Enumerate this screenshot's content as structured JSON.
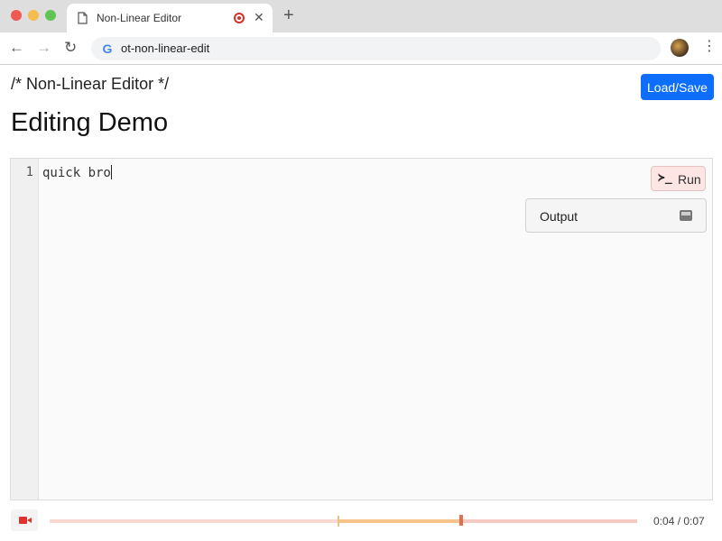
{
  "browser": {
    "tab_title": "Non-Linear Editor",
    "url": "ot-non-linear-edit",
    "new_tab": "+",
    "close": "✕"
  },
  "header": {
    "brand": "/* Non-Linear Editor */",
    "load_save_label": "Load/Save"
  },
  "main": {
    "title": "Editing Demo"
  },
  "editor": {
    "line_number": "1",
    "code": "quick bro",
    "run_label": "Run",
    "terminal_glyph": "≻_",
    "output_label": "Output"
  },
  "playback": {
    "time": "0:04 / 0:07",
    "progress_fraction": 0.7,
    "selection_start_fraction": 0.49,
    "selection_end_fraction": 0.7
  },
  "colors": {
    "accent": "#0d6efd",
    "record": "#e0312f",
    "run_bg": "#fde5e3"
  }
}
